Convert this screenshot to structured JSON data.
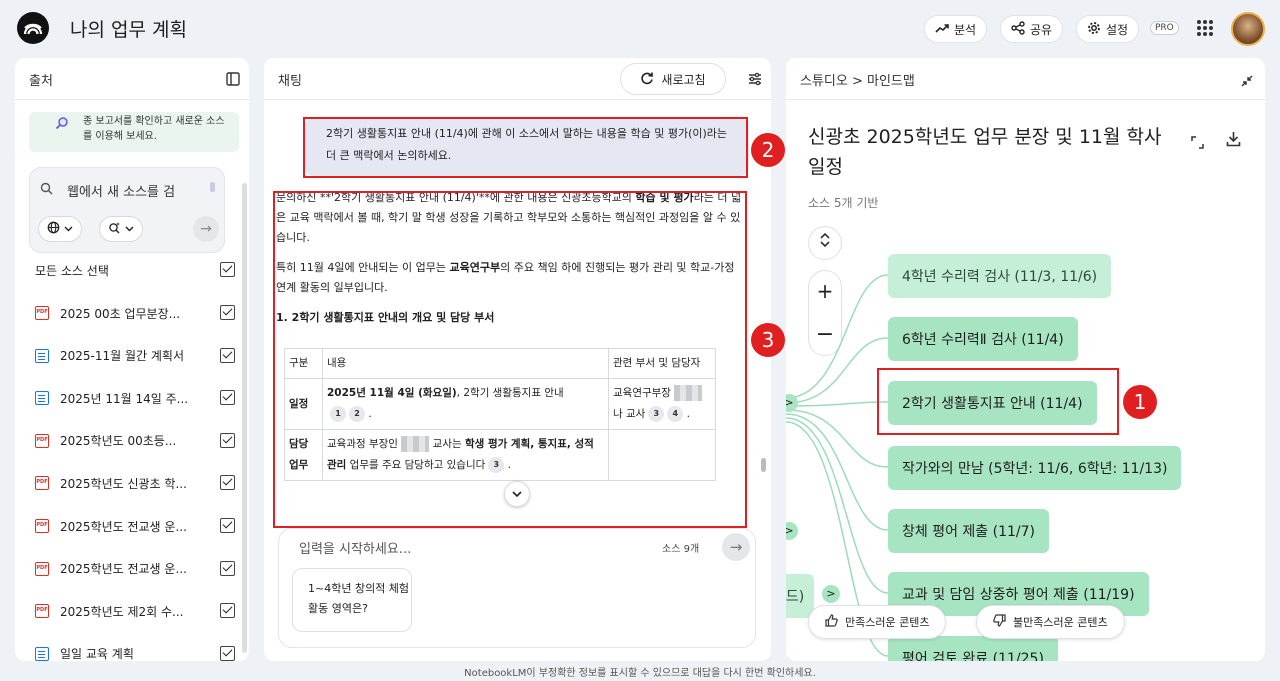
{
  "app": {
    "title": "나의 업무 계획"
  },
  "topbar": {
    "analysis_label": "분석",
    "share_label": "공유",
    "settings_label": "설정",
    "pro_badge": "PRO"
  },
  "sources": {
    "title": "출처",
    "hint": "종 보고서를 확인하고 새로운 소스를 이용해 보세요.",
    "search_placeholder": "웹에서 새 소스를 검",
    "select_all_label": "모든 소스 선택",
    "items": [
      {
        "label": "2025 00초 업무분장...",
        "icon": "pdf-icon"
      },
      {
        "label": "2025-11월 월간 계획서",
        "icon": "doc-icon"
      },
      {
        "label": "2025년 11월 14일 주...",
        "icon": "doc-icon"
      },
      {
        "label": "2025학년도 00초등...",
        "icon": "pdf-icon"
      },
      {
        "label": "2025학년도 신광초 학...",
        "icon": "pdf-icon"
      },
      {
        "label": "2025학년도 전교생 운...",
        "icon": "pdf-icon"
      },
      {
        "label": "2025학년도 전교생 운...",
        "icon": "pdf-icon"
      },
      {
        "label": "2025학년도 제2회 수...",
        "icon": "pdf-icon"
      },
      {
        "label": "일일 교육 계획",
        "icon": "doc-icon"
      }
    ]
  },
  "chat": {
    "title": "채팅",
    "refresh_label": "새로고침",
    "user_message": "2학기 생활통지표 안내 (11/4)에 관해 이 소스에서 말하는 내용을 학습 및 평가(이)라는 더 큰 맥락에서 논의하세요.",
    "answer": {
      "p1_a": "문의하신 **'2학기 생활통지표 안내 (11/4)'**에 관한 내용은 신광초등학교의 ",
      "p1_b": "학습 및 평가",
      "p1_c": "라는 더 넓은 교육 맥락에서 볼 때, 학기 말 학생 성장을 기록하고 학부모와 소통하는 핵심적인 과정임을 알 수 있습니다.",
      "p2_a": "특히 11월 4일에 안내되는 이 업무는 ",
      "p2_b": "교육연구부",
      "p2_c": "의 주요 책임 하에 진행되는 평가 관리 및 학교-가정 연계 활동의 일부입니다.",
      "heading": "1. 2학기 생활통지표 안내의 개요 및 담당 부서",
      "table": {
        "headers": [
          "구분",
          "내용",
          "관련 부서 및 담당자"
        ],
        "row1_label": "일정",
        "row1_bold": "2025년 11월 4일 (화요일)",
        "row1_text": ", 2학기 생활통지표 안내",
        "row1_cites": [
          "1",
          "2"
        ],
        "row1_dept_a": "교육연구부장",
        "row1_dept_b": "나 교사",
        "row1_dept_cites": [
          "3",
          "4"
        ],
        "row2_label": "담당 업무",
        "row2_a": "교육과정 부장인",
        "row2_b": "교사는 ",
        "row2_bold": "학생 평가 계획, 통지표, 성적 관리",
        "row2_c": " 업무를 주요 담당하고 있습니다",
        "row2_cite": "3"
      }
    },
    "input_placeholder": "입력을 시작하세요...",
    "source_count": "소스 9개",
    "suggestion": "1~4학년 창의적 체험활동 영역은?"
  },
  "studio": {
    "breadcrumb": "스튜디오 > 마인드맵",
    "title": "신광초 2025학년도 업무 분장 및 11월 학사일정",
    "subtitle": "소스 5개 기반",
    "nodes": [
      "4학년 수리력 검사 (11/3, 11/6)",
      "6학년 수리력Ⅱ 검사 (11/4)",
      "2학기 생활통지표 안내 (11/4)",
      "작가와의 만남 (5학년: 11/6, 6학년: 11/13)",
      "창체 평어 제출 (11/7)",
      "교과 및 담임 상중하 평어 제출 (11/19)",
      "평어 검토 완료 (11/25)"
    ],
    "partial_node": "드)",
    "like_label": "만족스러운 콘텐츠",
    "dislike_label": "불만족스러운 콘텐츠"
  },
  "annotations": [
    "1",
    "2",
    "3"
  ],
  "footer": "NotebookLM이 부정확한 정보를 표시할 수 있으므로 대답을 다시 한번 확인하세요.",
  "colors": {
    "node": "#a7e4c1",
    "node_light": "#c6efd8",
    "annotation": "#e02020",
    "background": "#eef1f6"
  }
}
